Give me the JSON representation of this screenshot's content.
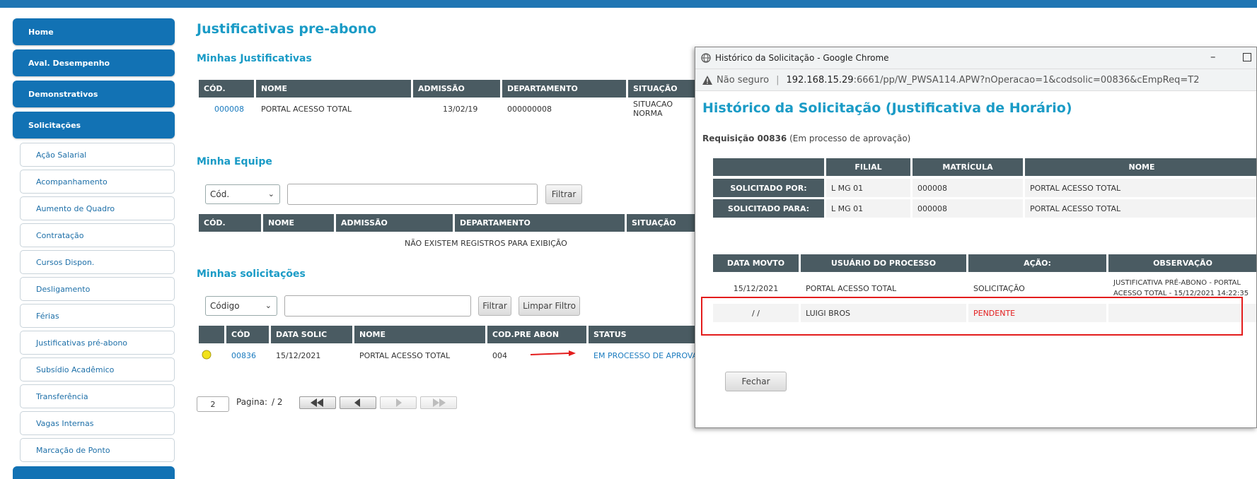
{
  "sidebar": {
    "main_items": [
      {
        "label": "Home"
      },
      {
        "label": "Aval. Desempenho"
      },
      {
        "label": "Demonstrativos"
      },
      {
        "label": "Solicitações"
      }
    ],
    "sub_items": [
      {
        "label": "Ação Salarial"
      },
      {
        "label": "Acompanhamento"
      },
      {
        "label": "Aumento de Quadro"
      },
      {
        "label": "Contratação"
      },
      {
        "label": "Cursos Dispon."
      },
      {
        "label": "Desligamento"
      },
      {
        "label": "Férias"
      },
      {
        "label": "Justificativas pré-abono"
      },
      {
        "label": "Subsídio Acadêmico"
      },
      {
        "label": "Transferência"
      },
      {
        "label": "Vagas Internas"
      },
      {
        "label": "Marcação de Ponto"
      }
    ]
  },
  "page": {
    "title": "Justificativas pre-abono"
  },
  "minhas_justificativas": {
    "title": "Minhas Justificativas",
    "headers": [
      "CÓD.",
      "NOME",
      "ADMISSÃO",
      "DEPARTAMENTO",
      "SITUAÇÃO"
    ],
    "row": {
      "cod": "000008",
      "nome": "PORTAL ACESSO TOTAL",
      "admissao": "13/02/19",
      "departamento": "000000008",
      "situacao": "SITUACAO NORMA"
    }
  },
  "minha_equipe": {
    "title": "Minha Equipe",
    "select_value": "Cód.",
    "filter_label": "Filtrar",
    "headers": [
      "CÓD.",
      "NOME",
      "ADMISSÃO",
      "DEPARTAMENTO",
      "SITUAÇÃO"
    ],
    "empty_text": "NÃO EXISTEM REGISTROS PARA EXIBIÇÃO"
  },
  "minhas_solicitacoes": {
    "title": "Minhas solicitações",
    "select_value": "Código",
    "filter_label": "Filtrar",
    "clear_label": "Limpar Filtro",
    "headers": [
      "CÓD",
      "DATA SOLIC",
      "NOME",
      "COD.PRE ABON",
      "STATUS"
    ],
    "row": {
      "cod": "00836",
      "data": "15/12/2021",
      "nome": "PORTAL ACESSO TOTAL",
      "cod_pre": "004",
      "status": "EM PROCESSO DE APROVAÇÃO"
    },
    "pager": {
      "page_input": "2",
      "label": "Pagina:",
      "total": "/ 2"
    }
  },
  "popup": {
    "window_title": "Histórico da Solicitação - Google Chrome",
    "not_secure": "Não seguro",
    "url_host": "192.168.15.29",
    "url_rest": ":6661/pp/W_PWSA114.APW?nOperacao=1&codsolic=00836&cEmpReq=T2",
    "heading": "Histórico da Solicitação (Justificativa de Horário)",
    "req_label": "Requisição 00836",
    "req_status": "(Em processo de aprovação)",
    "info_headers": [
      "FILIAL",
      "MATRÍCULA",
      "NOME"
    ],
    "info_rows": [
      {
        "label": "SOLICITADO POR:",
        "filial": "L MG 01",
        "matricula": "000008",
        "nome": "PORTAL ACESSO TOTAL"
      },
      {
        "label": "SOLICITADO PARA:",
        "filial": "L MG 01",
        "matricula": "000008",
        "nome": "PORTAL ACESSO TOTAL"
      }
    ],
    "hist_headers": [
      "DATA MOVTO",
      "USUÁRIO DO PROCESSO",
      "AÇÃO:",
      "OBSERVAÇÃO"
    ],
    "hist_rows": [
      {
        "data": "15/12/2021",
        "usuario": "PORTAL ACESSO TOTAL",
        "acao": "SOLICITAÇÃO",
        "obs": "JUSTIFICATIVA PRÉ-ABONO - PORTAL ACESSO TOTAL - 15/12/2021 14:22:35"
      },
      {
        "data": "/ /",
        "usuario": "LUIGI BROS",
        "acao": "PENDENTE",
        "obs": ""
      }
    ],
    "close_label": "Fechar"
  },
  "colors": {
    "accent": "#1a9bc6",
    "nav": "#1272b4",
    "header": "#4a5b62",
    "highlight": "#e31d1d"
  }
}
